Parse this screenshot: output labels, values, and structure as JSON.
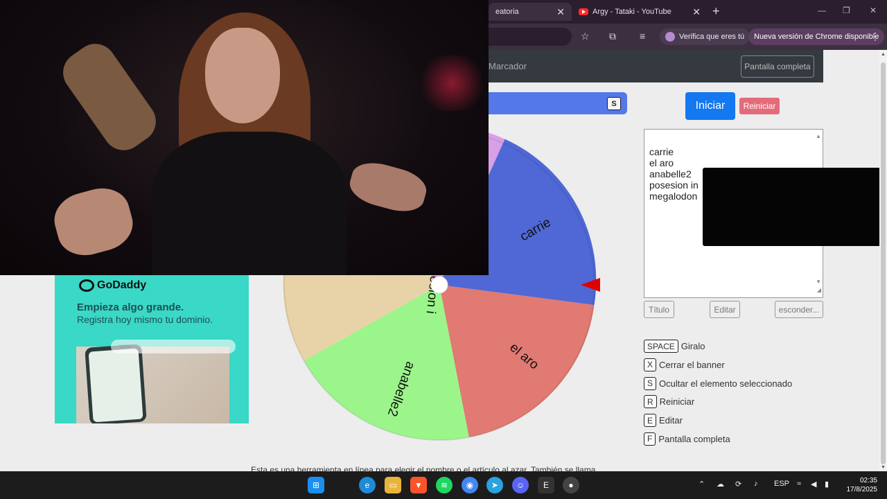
{
  "browser": {
    "tabs": [
      {
        "title": "eatoria",
        "active": true
      },
      {
        "title": "Argy - Tataki - YouTube",
        "active": false
      }
    ],
    "close_glyph": "✕",
    "new_tab_glyph": "+",
    "verify_label": "Verifica que eres tú",
    "update_label": "Nueva versión de Chrome disponible"
  },
  "site": {
    "nav_brand": "Marcador",
    "fullscreen_label": "Pantalla completa",
    "header_key": "S",
    "start_label": "Iniciar",
    "reset_label": "Reiniciar",
    "entries": [
      "carrie",
      "el aro",
      "anabelle2",
      "posesion in",
      "megalodon"
    ],
    "buttons": {
      "title": "Título",
      "edit": "Editar",
      "hide": "esconder..."
    },
    "shortcuts": [
      {
        "key": "SPACE",
        "label": "Giralo"
      },
      {
        "key": "X",
        "label": "Cerrar el banner"
      },
      {
        "key": "S",
        "label": "Ocultar el elemento seleccionado"
      },
      {
        "key": "R",
        "label": "Reiniciar"
      },
      {
        "key": "E",
        "label": "Editar"
      },
      {
        "key": "F",
        "label": "Pantalla completa"
      }
    ],
    "footer": "Esta es una herramienta en línea para elegir el nombre o el artículo al azar. También se llama"
  },
  "wheel": {
    "segments": [
      {
        "label": "carrie",
        "color": "#4f68d6"
      },
      {
        "label": "el aro",
        "color": "#e07a72"
      },
      {
        "label": "anabelle2",
        "color": "#9cf58a"
      },
      {
        "label": "posesion i",
        "color": "#e8d3a8"
      },
      {
        "label": "",
        "color": "#d8a0e6"
      }
    ],
    "pointer_color": "#e00000"
  },
  "ad": {
    "brand": "GoDaddy",
    "headline": "Empieza algo grande.",
    "subline": "Registra hoy mismo tu dominio.",
    "search_hint": "www."
  },
  "taskbar": {
    "lang": "ESP",
    "time": "02:35",
    "date": "17/8/2025",
    "apps": [
      "windows-start",
      "edge",
      "file-explorer",
      "brave",
      "spotify",
      "chrome",
      "telegram",
      "discord",
      "epic-games",
      "obs"
    ]
  },
  "colors": {
    "start_button": "#1478f0",
    "reset_button": "#e36c7a",
    "ad_background": "#3ad8c6"
  }
}
